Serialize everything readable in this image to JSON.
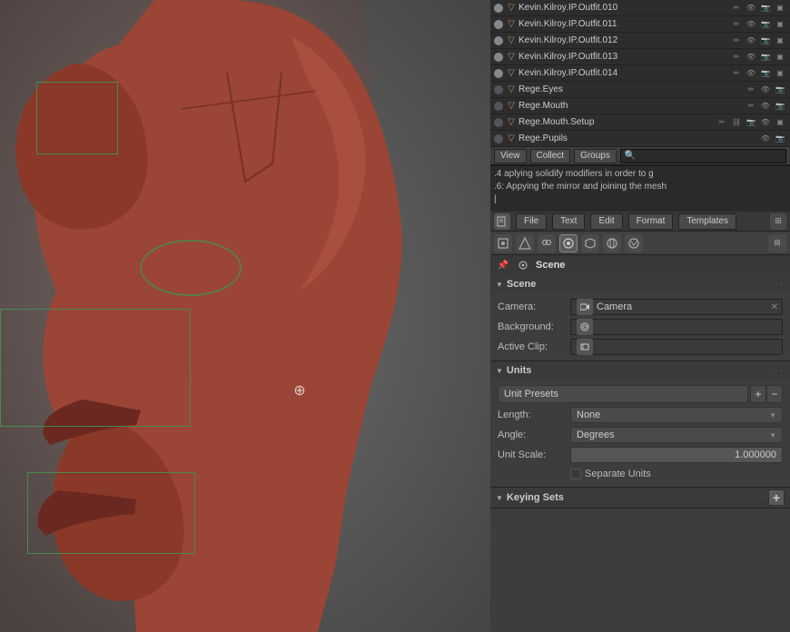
{
  "viewport": {
    "bg_color": "#5c5c5c"
  },
  "outliner": {
    "rows": [
      {
        "name": "Kevin.Kilroy.IP.Outfit.010",
        "dot": true,
        "icons": [
          "pencil",
          "eye",
          "camera",
          "box"
        ]
      },
      {
        "name": "Kevin.Kilroy.IP.Outfit.011",
        "dot": true,
        "icons": [
          "pencil",
          "eye",
          "camera",
          "box"
        ]
      },
      {
        "name": "Kevin.Kilroy.IP.Outfit.012",
        "dot": true,
        "icons": [
          "pencil",
          "eye",
          "camera",
          "box"
        ]
      },
      {
        "name": "Kevin.Kilroy.IP.Outfit.013",
        "dot": true,
        "icons": [
          "pencil",
          "eye",
          "camera",
          "box"
        ]
      },
      {
        "name": "Kevin.Kilroy.IP.Outfit.014",
        "dot": true,
        "icons": [
          "pencil",
          "eye",
          "camera",
          "box"
        ]
      },
      {
        "name": "Rege.Eyes",
        "dot": false,
        "icons": [
          "pencil",
          "eye",
          "camera"
        ]
      },
      {
        "name": "Rege.Mouth",
        "dot": false,
        "icons": [
          "pencil",
          "eye",
          "camera"
        ]
      },
      {
        "name": "Rege.Mouth.Setup",
        "dot": false,
        "icons": [
          "pencil",
          "camera",
          "eye",
          "box"
        ]
      },
      {
        "name": "Rege.Pupils",
        "dot": false,
        "icons": [
          "eye",
          "camera"
        ]
      }
    ],
    "topbar": {
      "view_label": "View",
      "collect_label": "Collect",
      "groups_label": "Groups",
      "search_placeholder": "🔍"
    }
  },
  "info": {
    "lines": [
      ".4 aplying solidify modifiers in order to g",
      ".6: Appying the mirror and joining the mesh",
      "|"
    ]
  },
  "properties": {
    "topbar": {
      "file_label": "File",
      "text_label": "Text",
      "edit_label": "Edit",
      "format_label": "Format",
      "templates_label": "Templates"
    },
    "icon_row": {
      "icons": [
        "camera",
        "triangle",
        "people",
        "sphere",
        "chain",
        "globe",
        "gear"
      ]
    },
    "scene_tab": {
      "label": "Scene",
      "icon": "↔"
    },
    "scene_section": {
      "title": "Scene",
      "camera_label": "Camera:",
      "camera_value": "Camera",
      "camera_icon": "📷",
      "background_label": "Background:",
      "background_icon": "🔗",
      "active_clip_label": "Active Clip:",
      "active_clip_icon": "🎬"
    },
    "units_section": {
      "title": "Units",
      "preset_label": "Unit Presets",
      "length_label": "Length:",
      "length_value": "None",
      "angle_label": "Angle:",
      "angle_value": "Degrees",
      "unit_scale_label": "Unit Scale:",
      "unit_scale_value": "1.000000",
      "separate_units_label": "Separate Units"
    },
    "keying_sets_section": {
      "title": "Keying Sets"
    }
  }
}
